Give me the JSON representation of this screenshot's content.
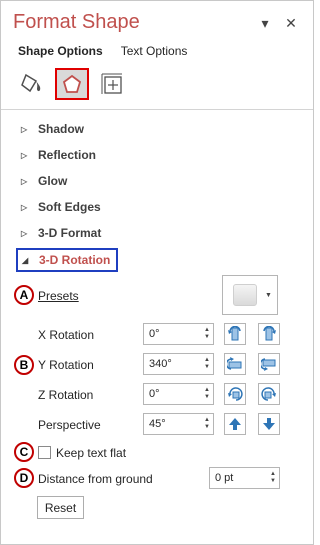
{
  "pane": {
    "title": "Format Shape",
    "dropdown_glyph": "▾",
    "close_glyph": "✕"
  },
  "tabs": {
    "shape_options": "Shape Options",
    "text_options": "Text Options"
  },
  "category_icons": [
    "fill-line-icon",
    "effects-pentagon-icon",
    "size-properties-icon"
  ],
  "sections": [
    {
      "label": "Shadow",
      "expanded": false
    },
    {
      "label": "Reflection",
      "expanded": false
    },
    {
      "label": "Glow",
      "expanded": false
    },
    {
      "label": "Soft Edges",
      "expanded": false
    },
    {
      "label": "3-D Format",
      "expanded": false
    },
    {
      "label": "3-D Rotation",
      "expanded": true
    }
  ],
  "badges": {
    "a": "A",
    "b": "B",
    "c": "C",
    "d": "D"
  },
  "rotation": {
    "presets_label": "Presets",
    "x_label": "X Rotation",
    "x_value": "0°",
    "y_label": "Y Rotation",
    "y_value": "340°",
    "z_label": "Z Rotation",
    "z_value": "0°",
    "perspective_label": "Perspective",
    "perspective_value": "45°",
    "keep_text_flat_label": "Keep text flat",
    "keep_text_flat_checked": false,
    "distance_label": "Distance from ground",
    "distance_value": "0 pt",
    "reset_label": "Reset"
  },
  "colors": {
    "accent": "#c0504d",
    "badge_ring": "#c00000",
    "highlight_box": "#1f3fc0",
    "selected_icon_box": "#e00000",
    "arrow_blue": "#2e75b6"
  }
}
